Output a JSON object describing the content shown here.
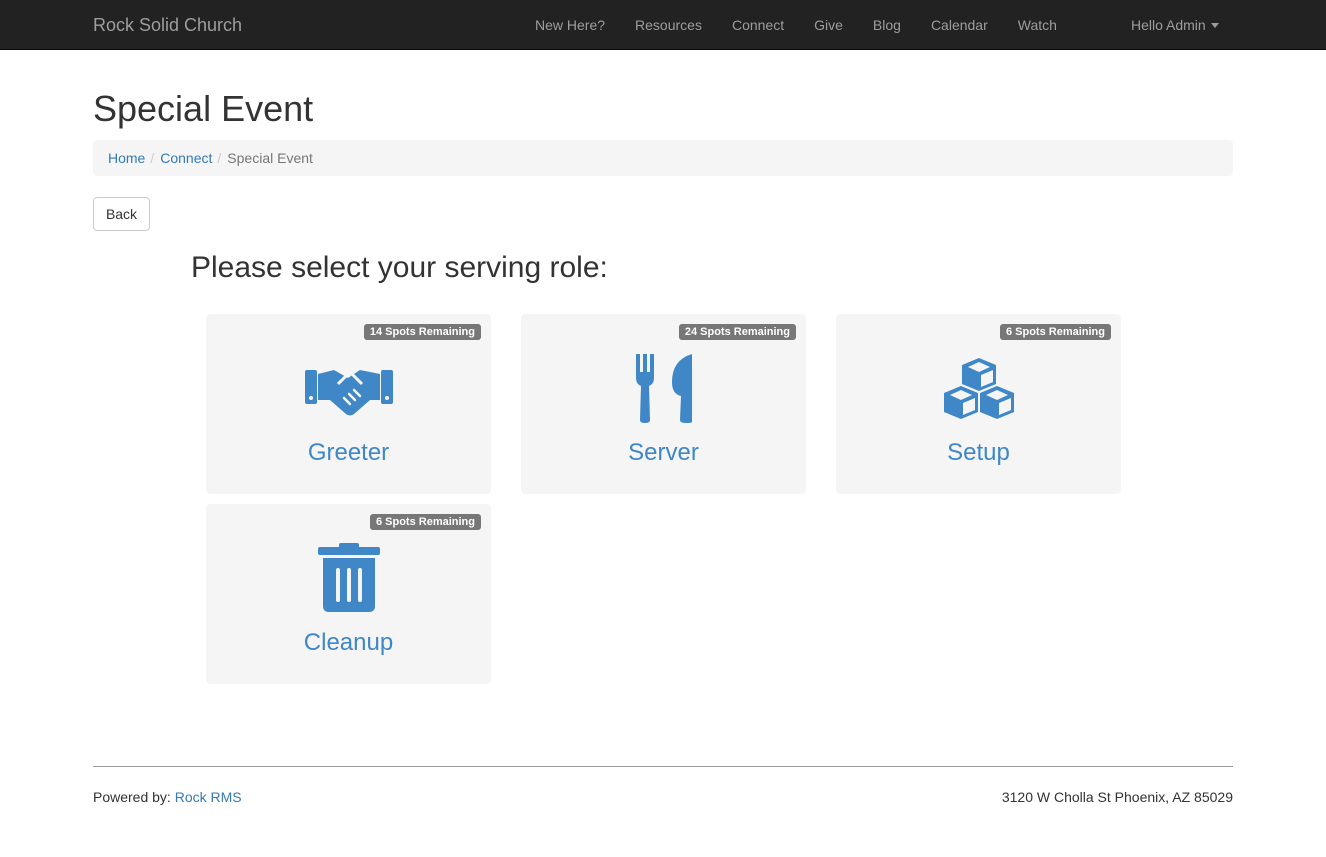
{
  "navbar": {
    "brand": "Rock Solid Church",
    "links": [
      "New Here?",
      "Resources",
      "Connect",
      "Give",
      "Blog",
      "Calendar",
      "Watch"
    ],
    "user": "Hello Admin"
  },
  "page": {
    "title": "Special Event"
  },
  "breadcrumb": {
    "items": [
      "Home",
      "Connect"
    ],
    "active": "Special Event"
  },
  "back_button": "Back",
  "prompt": "Please select your serving role:",
  "roles": [
    {
      "name": "Greeter",
      "spots": "14 Spots Remaining",
      "icon": "handshake-icon"
    },
    {
      "name": "Server",
      "spots": "24 Spots Remaining",
      "icon": "utensils-icon"
    },
    {
      "name": "Setup",
      "spots": "6 Spots Remaining",
      "icon": "cubes-icon"
    },
    {
      "name": "Cleanup",
      "spots": "6 Spots Remaining",
      "icon": "trash-icon"
    }
  ],
  "colors": {
    "navbar_bg": "#222222",
    "icon_blue": "#3f87c6",
    "link_blue": "#337ab7",
    "tile_bg": "#f5f5f5",
    "badge_bg": "#777777"
  },
  "footer": {
    "powered_prefix": "Powered by: ",
    "powered_link": "Rock RMS",
    "address": "3120 W Cholla St Phoenix, AZ 85029"
  }
}
